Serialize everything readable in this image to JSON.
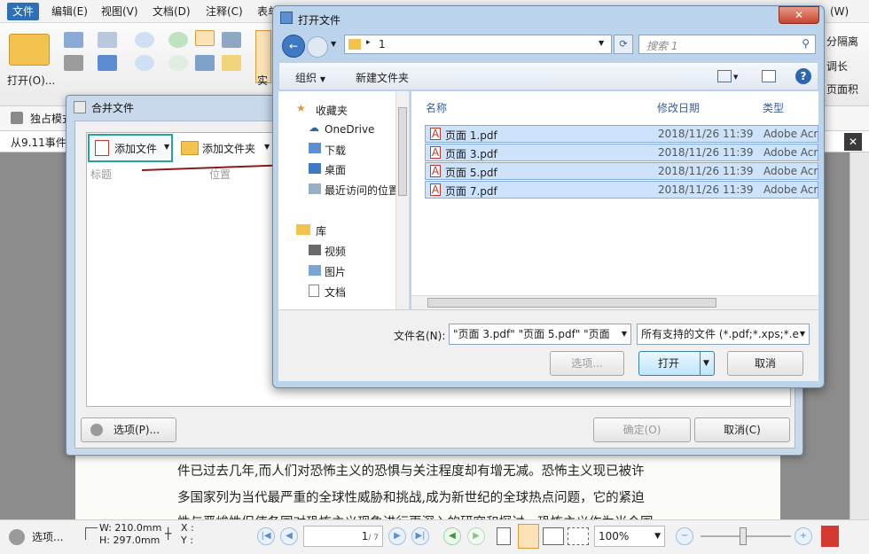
{
  "menubar": {
    "items": [
      "文件",
      "编辑(E)",
      "视图(V)",
      "文档(D)",
      "注释(C)",
      "表单"
    ],
    "right_items": [
      "(W)"
    ]
  },
  "ribbon": {
    "open_label": "打开(O)...",
    "print_label": "实",
    "right_labels": [
      "分隔离",
      "调长",
      "页面积"
    ]
  },
  "tabbar": {
    "tab_label": "独占模式"
  },
  "doctabs": {
    "tab_label": "从9.11事件"
  },
  "merge_dialog": {
    "title": "合并文件",
    "add_file": "添加文件",
    "add_folder": "添加文件夹",
    "col_title": "标题",
    "col_position": "位置",
    "options": "选项(P)...",
    "ok": "确定(O)",
    "cancel": "取消(C)"
  },
  "open_dialog": {
    "title": "打开文件",
    "path_folder": "1",
    "search_placeholder": "搜索 1",
    "organize": "组织",
    "new_folder": "新建文件夹",
    "nav": {
      "favorites": "收藏夹",
      "onedrive": "OneDrive",
      "downloads": "下载",
      "desktop": "桌面",
      "recent": "最近访问的位置",
      "library": "库",
      "videos": "视频",
      "pictures": "图片",
      "documents": "文档"
    },
    "columns": {
      "name": "名称",
      "modified": "修改日期",
      "type": "类型"
    },
    "files": [
      {
        "name": "页面 1.pdf",
        "date": "2018/11/26 11:39",
        "type": "Adobe Acr"
      },
      {
        "name": "页面 3.pdf",
        "date": "2018/11/26 11:39",
        "type": "Adobe Acr"
      },
      {
        "name": "页面 5.pdf",
        "date": "2018/11/26 11:39",
        "type": "Adobe Acr"
      },
      {
        "name": "页面 7.pdf",
        "date": "2018/11/26 11:39",
        "type": "Adobe Acr"
      }
    ],
    "filename_label": "文件名(N):",
    "filename_value": "\"页面 3.pdf\" \"页面 5.pdf\" \"页面",
    "filetype_value": "所有支持的文件 (*.pdf;*.xps;*.e",
    "options_btn": "选项...",
    "open_btn": "打开",
    "cancel_btn": "取消"
  },
  "document": {
    "lines": [
      "件已过去几年,而人们对恐怖主义的恐惧与关注程度却有增无减。恐怖主义现已被许",
      "多国家列为当代最严重的全球性威胁和挑战,成为新世纪的全球热点问题，它的紧迫",
      "性与严峻性促使各国对恐怖主义现象进行更深入的研究和探讨。恐怖主义作为当今国"
    ]
  },
  "statusbar": {
    "options": "选项...",
    "width": "W: 210.0mm",
    "height": "H: 297.0mm",
    "x": "X :",
    "y": "Y :",
    "page_current": "1",
    "page_total": "/ 7",
    "zoom": "100%"
  }
}
